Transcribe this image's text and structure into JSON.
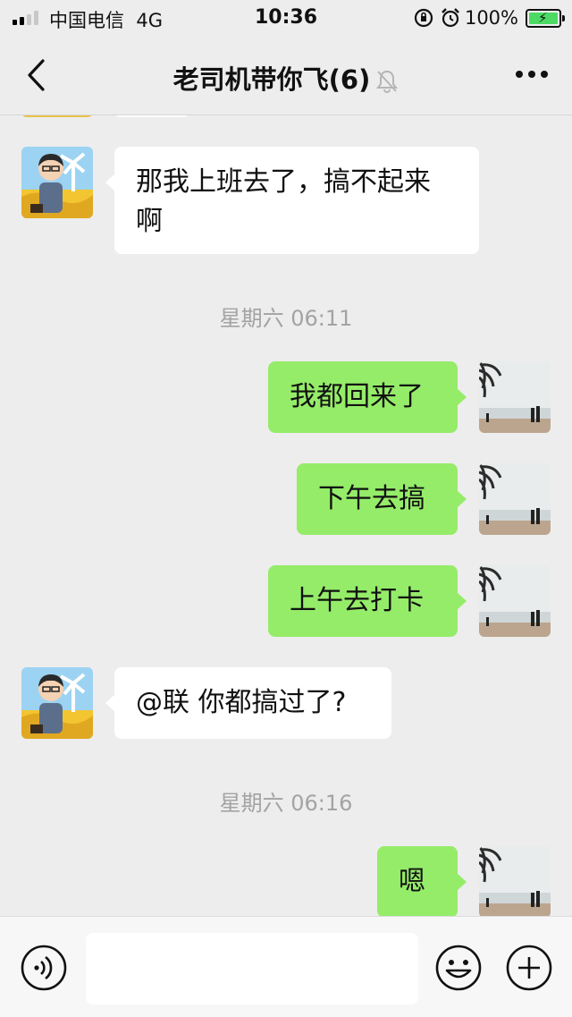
{
  "status": {
    "carrier": "中国电信",
    "network": "4G",
    "time": "10:36",
    "battery": "100%",
    "battery_level": 1.0
  },
  "nav": {
    "title": "老司机带你飞(6)",
    "back_icon": "chevron-left-icon",
    "mute_icon": "bell-slash-icon",
    "more_icon": "ellipsis-icon"
  },
  "messages": [
    {
      "side": "left",
      "text_line1": "那我上班去了，搞不起来",
      "text_line2": "啊"
    },
    {
      "type": "time",
      "text": "星期六 06:11"
    },
    {
      "side": "right",
      "text": "我都回来了"
    },
    {
      "side": "right",
      "text": "下午去搞"
    },
    {
      "side": "right",
      "text": "上午去打卡"
    },
    {
      "side": "left",
      "text": "@联 你都搞过了?"
    },
    {
      "type": "time",
      "text": "星期六 06:16"
    },
    {
      "side": "right",
      "text": "嗯"
    }
  ],
  "input": {
    "voice_icon": "voice-icon",
    "emoji_icon": "emoji-icon",
    "plus_icon": "plus-circle-icon",
    "value": ""
  },
  "colors": {
    "background": "#ededed",
    "self_bubble": "#95ec69",
    "other_bubble": "#ffffff",
    "timestamp": "#a3a3a3"
  }
}
